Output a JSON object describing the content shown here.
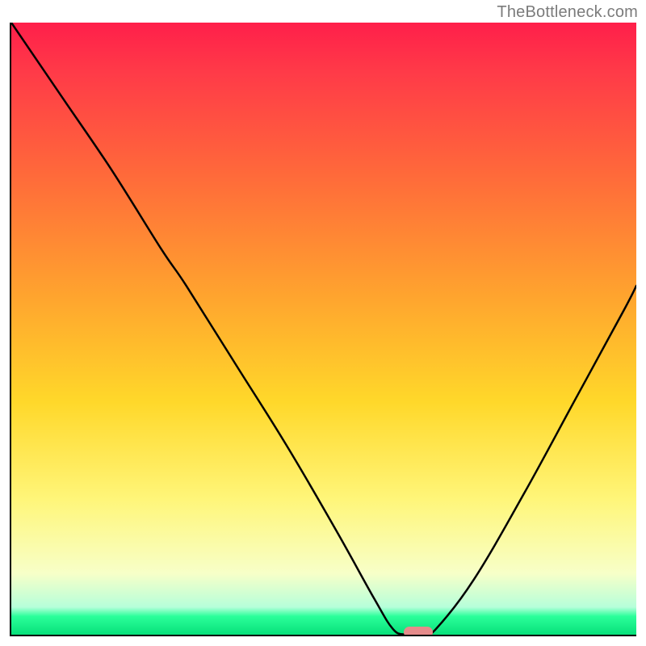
{
  "attribution": "TheBottleneck.com",
  "colors": {
    "gradient_top": "#ff1f4a",
    "gradient_mid1": "#ff6a3a",
    "gradient_mid2": "#ffd82a",
    "gradient_low": "#f7ffc8",
    "gradient_bottom": "#07e07a",
    "curve": "#000000",
    "marker": "#e58b8b",
    "axis": "#000000",
    "attribution_text": "#7b7b7b"
  },
  "chart_data": {
    "type": "line",
    "title": "",
    "xlabel": "",
    "ylabel": "",
    "xlim": [
      0,
      100
    ],
    "ylim": [
      0,
      100
    ],
    "grid": false,
    "legend": false,
    "series": [
      {
        "name": "bottleneck-curve",
        "x": [
          0,
          8,
          16,
          24,
          28,
          36,
          44,
          52,
          58,
          61,
          63,
          66,
          68,
          74,
          82,
          90,
          98,
          100
        ],
        "y": [
          100,
          88,
          76,
          63,
          57,
          44,
          31,
          17,
          6,
          1,
          0,
          0,
          1,
          9,
          23,
          38,
          53,
          57
        ]
      }
    ],
    "marker": {
      "x": 65,
      "y": 0.7,
      "shape": "pill"
    },
    "background": {
      "type": "vertical-gradient",
      "stops": [
        {
          "pos": 0,
          "color": "#ff1f4a"
        },
        {
          "pos": 0.25,
          "color": "#ff6a3a"
        },
        {
          "pos": 0.62,
          "color": "#ffd82a"
        },
        {
          "pos": 0.9,
          "color": "#f7ffc8"
        },
        {
          "pos": 1.0,
          "color": "#07e07a"
        }
      ]
    }
  }
}
